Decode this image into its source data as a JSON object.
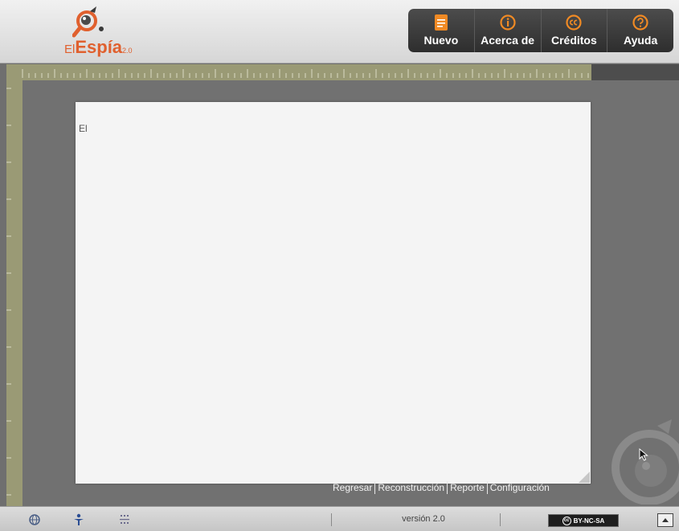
{
  "app": {
    "logo": {
      "prefix": "El",
      "name": "Espía",
      "version": "2.0"
    }
  },
  "menu": {
    "nuevo": {
      "label": "Nuevo",
      "icon": "document-icon",
      "color": "#f08a24"
    },
    "acerca": {
      "label": "Acerca de",
      "icon": "info-icon",
      "color": "#f08a24"
    },
    "creditos": {
      "label": "Créditos",
      "icon": "creative-commons-icon",
      "color": "#f08a24"
    },
    "ayuda": {
      "label": "Ayuda",
      "icon": "help-icon",
      "color": "#f08a24"
    }
  },
  "paper": {
    "text": "El"
  },
  "footer_links": {
    "regresar": "Regresar",
    "reconstruccion": "Reconstrucción",
    "reporte": "Reporte",
    "configuracion": "Configuración"
  },
  "status": {
    "version": "versión 2.0",
    "license": "BY-NC-SA",
    "icons": [
      "globe-icon",
      "figure-icon",
      "grid-icon"
    ]
  },
  "colors": {
    "accent": "#e0602e",
    "menu_icon": "#f08a24",
    "ruler": "#9a9a75",
    "paper": "#f4f4f4"
  }
}
